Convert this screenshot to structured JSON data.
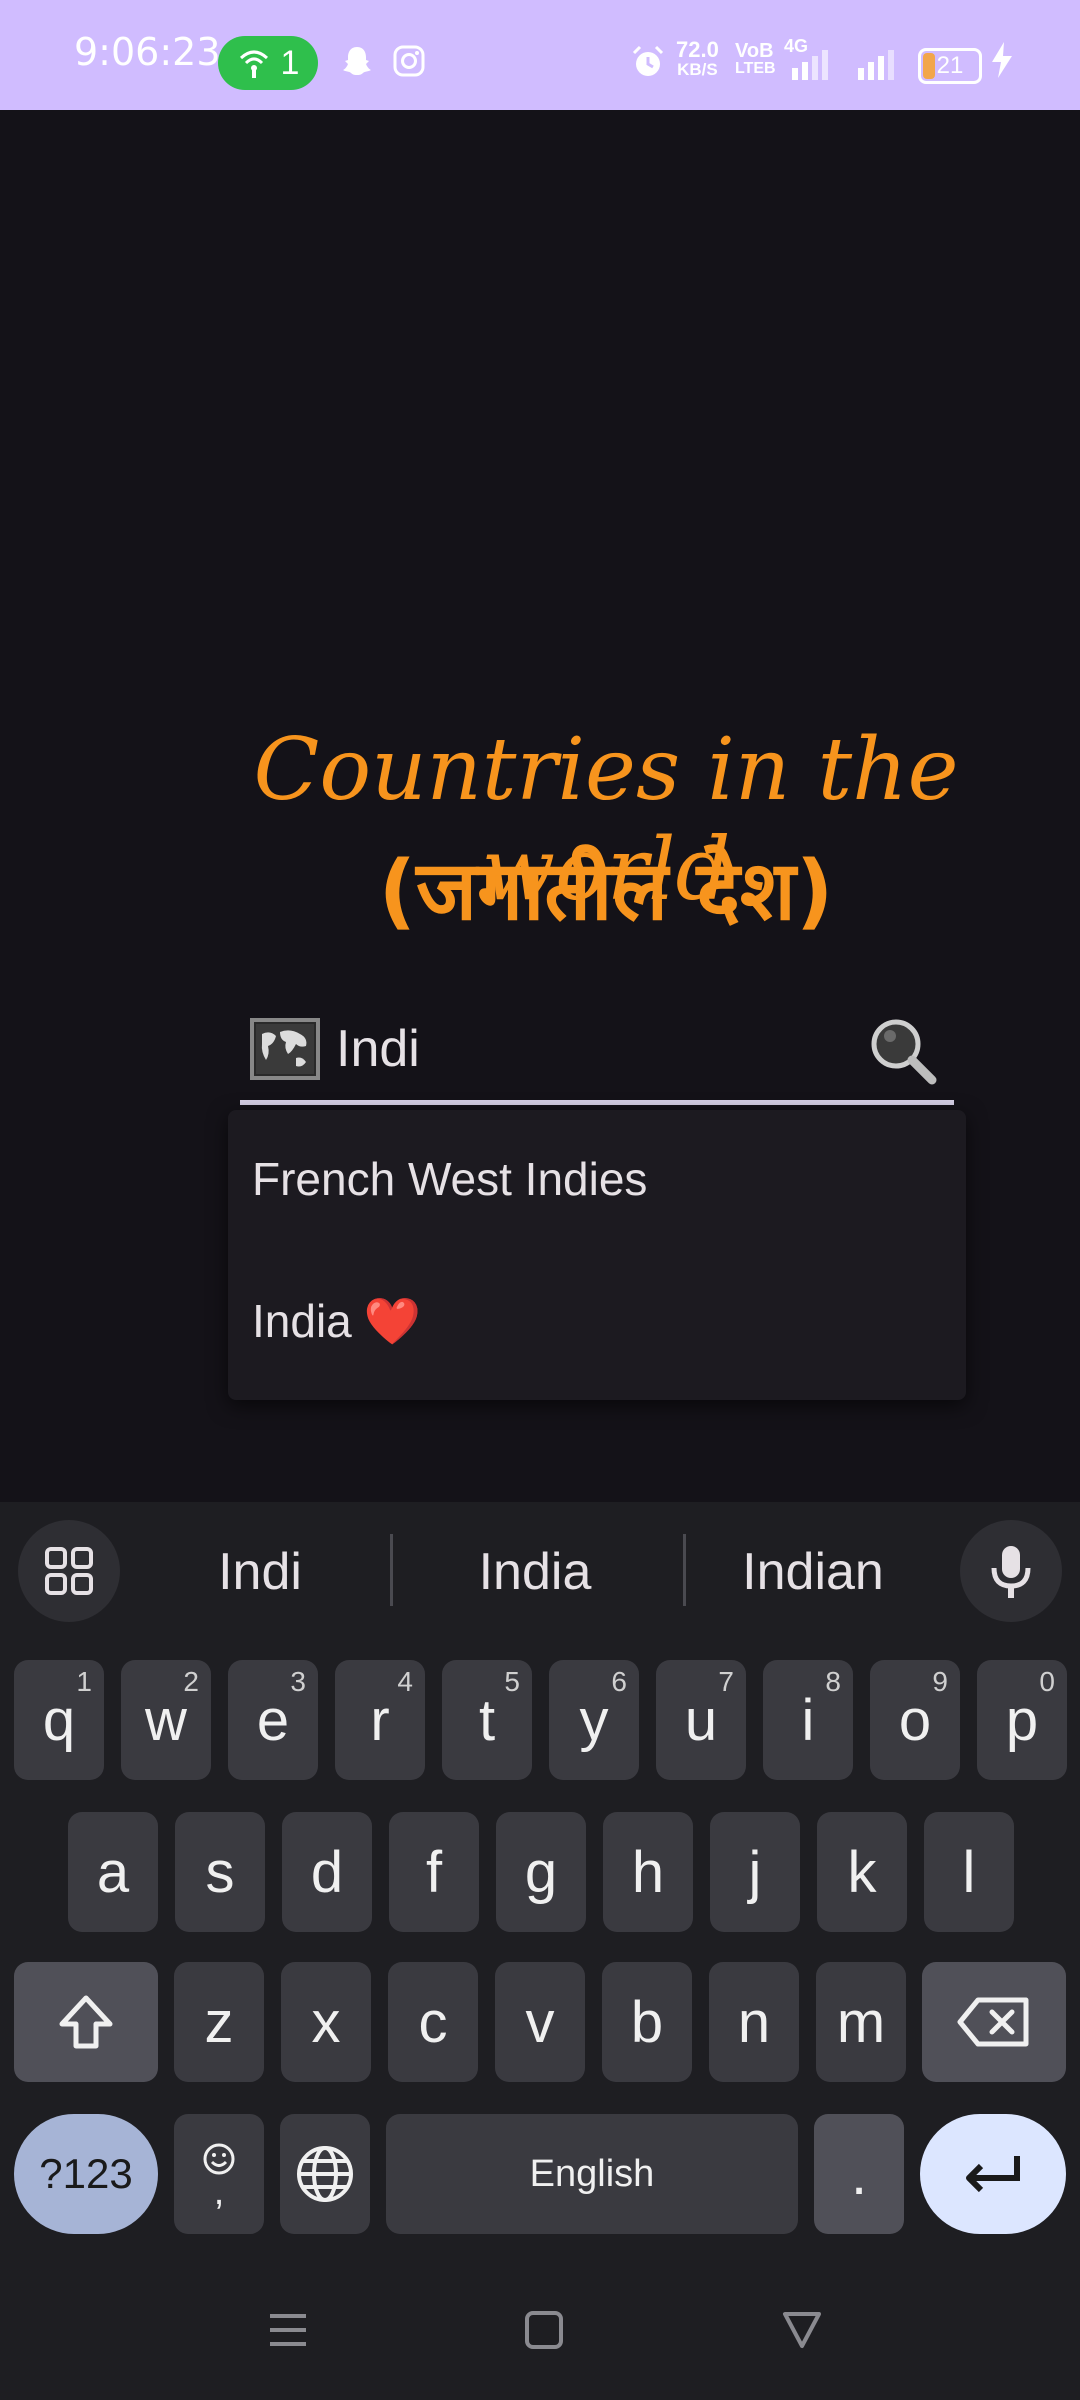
{
  "status_bar": {
    "time": "9:06:23",
    "hotspot_count": "1",
    "net_speed_value": "72.0",
    "net_speed_unit": "KB/S",
    "volte_top": "VoB",
    "volte_bottom": "LTEB",
    "network": "4G",
    "battery": "21",
    "icons": [
      "hotspot-icon",
      "snapchat-icon",
      "instagram-icon",
      "alarm-icon",
      "signal-icon",
      "battery-icon",
      "charging-icon"
    ]
  },
  "app": {
    "title_line1": "Countries in the world",
    "title_line2": "(जगातील देश)",
    "search": {
      "value": "Indi",
      "placeholder": ""
    },
    "dropdown": [
      {
        "label": "French West Indies",
        "emoji": ""
      },
      {
        "label": "India",
        "emoji": "❤️"
      }
    ],
    "accent_color": "#f7941d"
  },
  "keyboard": {
    "suggestions": [
      "Indi",
      "India",
      "Indian"
    ],
    "row1": [
      {
        "k": "q",
        "n": "1"
      },
      {
        "k": "w",
        "n": "2"
      },
      {
        "k": "e",
        "n": "3"
      },
      {
        "k": "r",
        "n": "4"
      },
      {
        "k": "t",
        "n": "5"
      },
      {
        "k": "y",
        "n": "6"
      },
      {
        "k": "u",
        "n": "7"
      },
      {
        "k": "i",
        "n": "8"
      },
      {
        "k": "o",
        "n": "9"
      },
      {
        "k": "p",
        "n": "0"
      }
    ],
    "row2": [
      "a",
      "s",
      "d",
      "f",
      "g",
      "h",
      "j",
      "k",
      "l"
    ],
    "row3": [
      "z",
      "x",
      "c",
      "v",
      "b",
      "n",
      "m"
    ],
    "symbols_label": "?123",
    "comma_label": ",",
    "space_label": "English",
    "period_label": "."
  }
}
